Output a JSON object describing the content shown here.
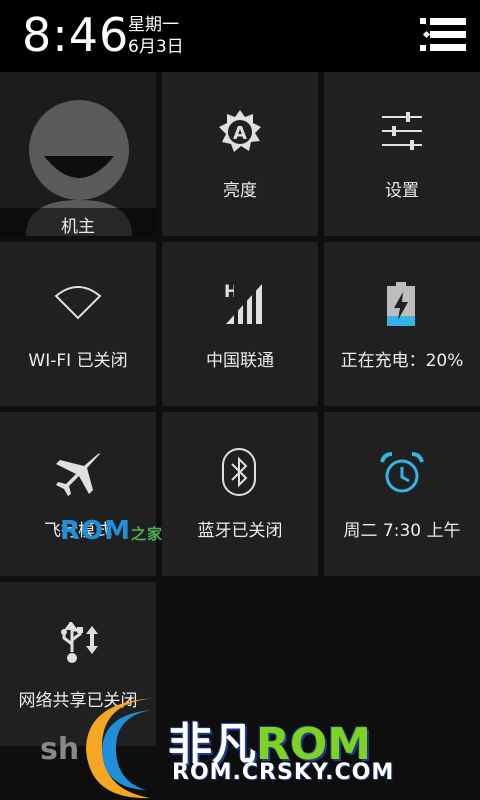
{
  "status": {
    "time": "8:46",
    "weekday": "星期一",
    "date": "6月3日"
  },
  "tiles": [
    {
      "label": "机主",
      "icon": "avatar-icon"
    },
    {
      "label": "亮度",
      "icon": "brightness-auto-icon"
    },
    {
      "label": "设置",
      "icon": "settings-sliders-icon"
    },
    {
      "label": "WI-FI 已关闭",
      "icon": "wifi-icon"
    },
    {
      "label": "中国联通",
      "icon": "signal-icon"
    },
    {
      "label": "正在充电：20%",
      "icon": "battery-charging-icon"
    },
    {
      "label": "飞行模式",
      "icon": "airplane-icon"
    },
    {
      "label": "蓝牙已关闭",
      "icon": "bluetooth-icon"
    },
    {
      "label": "周二 7:30 上午",
      "icon": "alarm-clock-icon"
    },
    {
      "label": "网络共享已关闭",
      "icon": "usb-icon"
    }
  ],
  "signal": {
    "network_type": "H"
  },
  "watermark": {
    "rom_text": "ROM",
    "home_text": "之家"
  },
  "footer": {
    "brand_fei_fan": "非凡",
    "brand_rom": "ROM",
    "site": "ROM.CRSKY.COM",
    "sh_text": "sh"
  },
  "colors": {
    "accent_blue": "#33b5e5",
    "tile_bg": "#202020",
    "page_bg": "#0e0e0e"
  }
}
